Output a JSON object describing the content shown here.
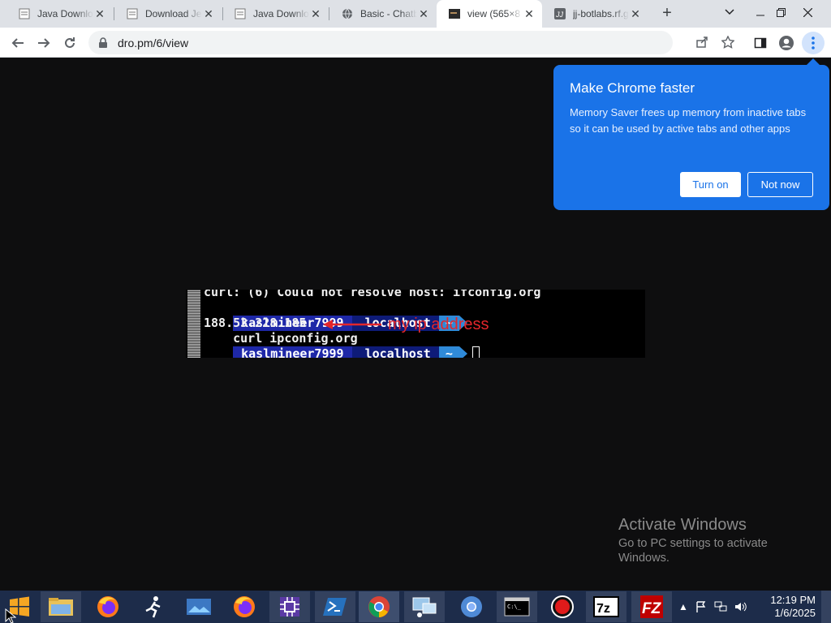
{
  "browser": {
    "tabs": [
      {
        "title": "Java Downlo",
        "favicon": "page-icon",
        "active": false
      },
      {
        "title": "Download Je",
        "favicon": "page-icon",
        "active": false
      },
      {
        "title": "Java Downlo",
        "favicon": "page-icon",
        "active": false
      },
      {
        "title": "Basic - Chatb",
        "favicon": "globe-icon",
        "active": false
      },
      {
        "title": "view (565×8",
        "favicon": "image-icon",
        "active": true
      },
      {
        "title": "jj-botlabs.rf.g",
        "favicon": "jj-icon",
        "active": false
      }
    ],
    "url": "dro.pm/6/view"
  },
  "promo": {
    "title": "Make Chrome faster",
    "body": "Memory Saver frees up memory from inactive tabs so it can be used by active tabs and other apps",
    "turn_on": "Turn on",
    "not_now": "Not now"
  },
  "terminal": {
    "line0": "curl: (6) Could not resolve host: ifconfig.org",
    "user": "kaslmineer7999",
    "host": "localhost",
    "dir": "~",
    "command": "curl ipconfig.org",
    "ip": "188.53.228.185",
    "annotation": "my ip address"
  },
  "watermark": {
    "title": "Activate Windows",
    "line1": "Go to PC settings to activate",
    "line2": "Windows."
  },
  "taskbar": {
    "time": "12:19 PM",
    "date": "1/6/2025",
    "apps": [
      "file-explorer-icon",
      "firefox-icon",
      "runner-icon",
      "photos-icon",
      "firefox-icon",
      "chip-icon",
      "powershell-icon",
      "chrome-icon",
      "network-tool-icon",
      "chromium-icon",
      "cmd-icon",
      "record-icon",
      "7zip-icon",
      "filezilla-icon"
    ]
  },
  "colors": {
    "promo_bg": "#1a73e8",
    "taskbar_bg": "#1d2c4a",
    "annotation_red": "#e3262b"
  }
}
